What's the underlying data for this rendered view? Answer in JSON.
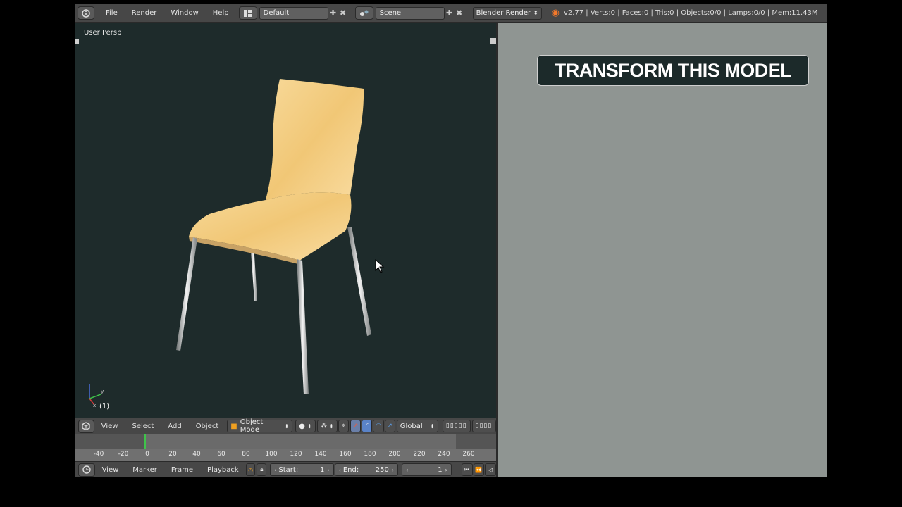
{
  "menus": [
    "File",
    "Render",
    "Window",
    "Help"
  ],
  "screen_layout": "Default",
  "scene": "Scene",
  "render_engine": "Blender Render",
  "info_stats": "v2.77 | Verts:0 | Faces:0 | Tris:0 | Objects:0/0 | Lamps:0/0 | Mem:11.43M",
  "viewport": {
    "label": "User Persp",
    "frame_indicator": "(1)"
  },
  "view3d_header": {
    "menus": [
      "View",
      "Select",
      "Add",
      "Object"
    ],
    "mode": "Object Mode",
    "orientation": "Global"
  },
  "timeline": {
    "ticks": [
      "-40",
      "-20",
      "0",
      "20",
      "40",
      "60",
      "80",
      "100",
      "120",
      "140",
      "160",
      "180",
      "200",
      "220",
      "240",
      "260"
    ],
    "current_frame": 1
  },
  "timeline_header": {
    "menus": [
      "View",
      "Marker",
      "Frame",
      "Playback"
    ],
    "start_label": "Start:",
    "start_value": "1",
    "end_label": "End:",
    "end_value": "250",
    "current_value": "1"
  },
  "banner_text": "TRANSFORM THIS MODEL",
  "colors": {
    "viewport_bg": "#1e2b2b",
    "panel_bg": "#8f9592",
    "chair_wood": "#f2cf7f",
    "playhead": "#3fc34a"
  }
}
